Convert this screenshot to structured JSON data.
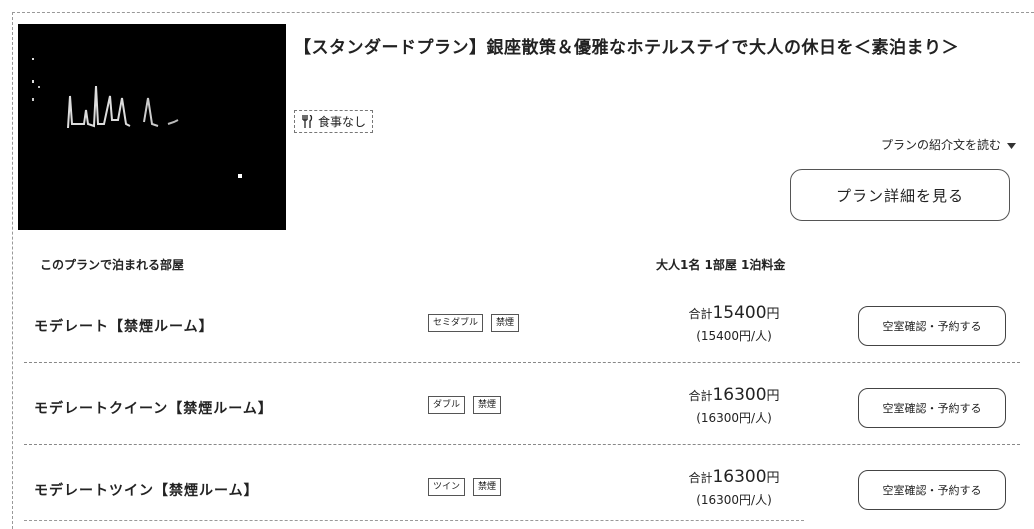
{
  "plan": {
    "title": "【スタンダードプラン】銀座散策＆優雅なホテルステイで大人の休日を＜素泊まり＞",
    "meal_tag": "食事なし",
    "read_more_label": "プランの紹介文を読む",
    "detail_button": "プラン詳細を見る"
  },
  "table": {
    "rooms_header": "このプランで泊まれる部屋",
    "price_header": "大人1名 1部屋 1泊料金"
  },
  "rooms": [
    {
      "name": "モデレート【禁煙ルーム】",
      "badges": [
        "セミダブル",
        "禁煙"
      ],
      "total_label": "合計",
      "total_amount": "15400",
      "currency": "円",
      "per_person": "(15400円/人)",
      "book_label": "空室確認・予約する"
    },
    {
      "name": "モデレートクイーン【禁煙ルーム】",
      "badges": [
        "ダブル",
        "禁煙"
      ],
      "total_label": "合計",
      "total_amount": "16300",
      "currency": "円",
      "per_person": "(16300円/人)",
      "book_label": "空室確認・予約する"
    },
    {
      "name": "モデレートツイン【禁煙ルーム】",
      "badges": [
        "ツイン",
        "禁煙"
      ],
      "total_label": "合計",
      "total_amount": "16300",
      "currency": "円",
      "per_person": "(16300円/人)",
      "book_label": "空室確認・予約する"
    }
  ],
  "icons": {
    "meal": "cutlery-icon",
    "expand": "chevron-down-icon"
  }
}
